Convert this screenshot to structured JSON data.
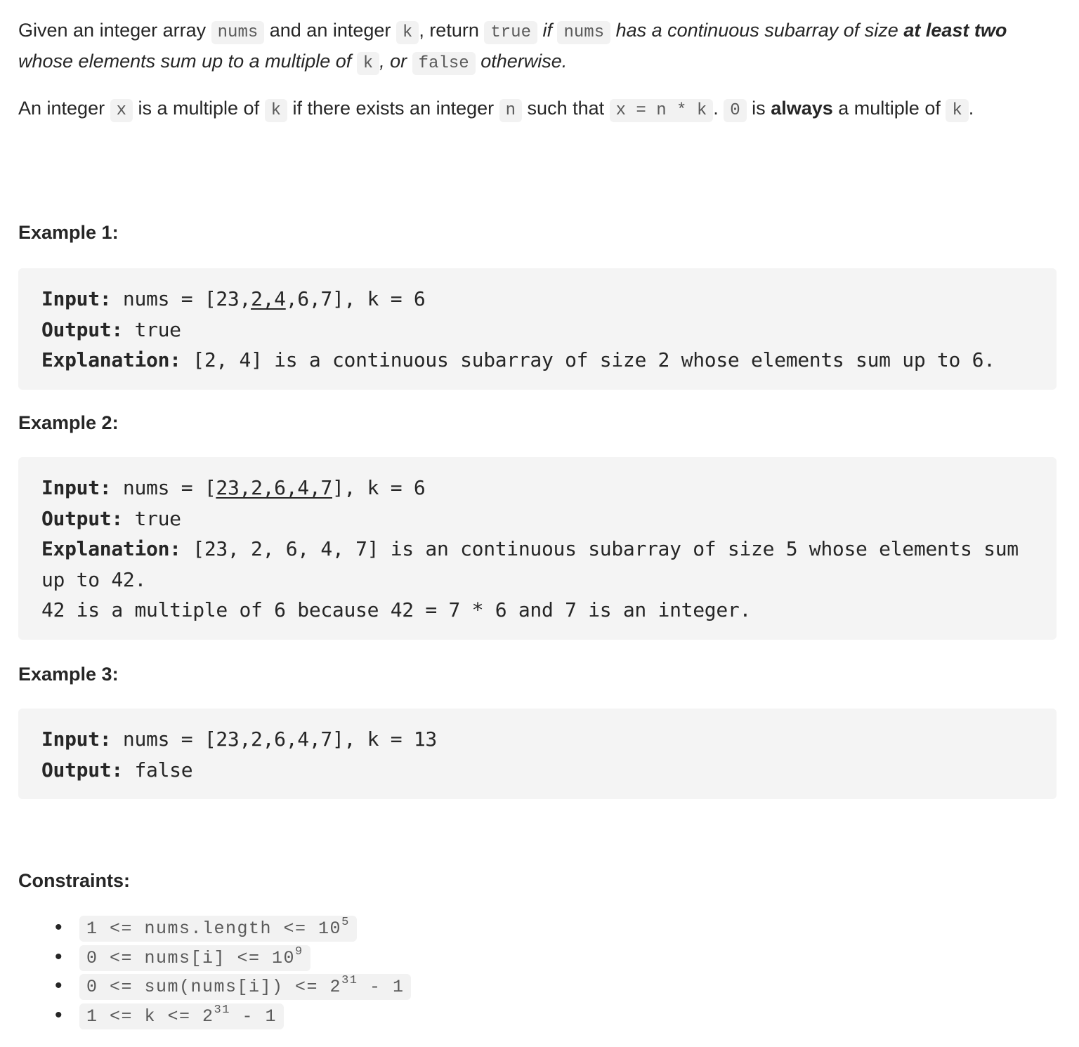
{
  "description": {
    "p1": {
      "t1": "Given an integer array ",
      "c1": "nums",
      "t2": " and an integer ",
      "c2": "k",
      "t3": ", return ",
      "c3": "true",
      "i1": " if ",
      "c4": "nums",
      "i2": " has a continuous subarray of size ",
      "b1": "at least two",
      "i3": " whose elements sum up to a multiple of ",
      "c5": "k",
      "i4": ", or ",
      "c6": "false",
      "i5": " otherwise."
    },
    "p2": {
      "t1": "An integer ",
      "c1": "x",
      "t2": " is a multiple of ",
      "c2": "k",
      "t3": " if there exists an integer ",
      "c3": "n",
      "t4": " such that ",
      "c4": "x = n * k",
      "t5": ". ",
      "c5": "0",
      "t6": " is ",
      "b1": "always",
      "t7": " a multiple of ",
      "c6": "k",
      "t8": "."
    }
  },
  "examples": [
    {
      "title": "Example 1:",
      "input_label": "Input:",
      "input_prefix": " nums = [23,",
      "input_underlined": "2,4",
      "input_suffix": ",6,7], k = 6",
      "output_label": "Output:",
      "output_value": " true",
      "explanation_label": "Explanation:",
      "explanation_text": " [2, 4] is a continuous subarray of size 2 whose elements sum up to 6."
    },
    {
      "title": "Example 2:",
      "input_label": "Input:",
      "input_prefix": " nums = [",
      "input_underlined": "23,2,6,4,7",
      "input_suffix": "], k = 6",
      "output_label": "Output:",
      "output_value": " true",
      "explanation_label": "Explanation:",
      "explanation_text": " [23, 2, 6, 4, 7] is an continuous subarray of size 5 whose elements sum up to 42.\n42 is a multiple of 6 because 42 = 7 * 6 and 7 is an integer."
    },
    {
      "title": "Example 3:",
      "input_label": "Input:",
      "input_value": " nums = [23,2,6,4,7], k = 13",
      "output_label": "Output:",
      "output_value": " false"
    }
  ],
  "constraints": {
    "title": "Constraints:",
    "items": [
      {
        "base": "1 <= nums.length <= 10",
        "sup": "5",
        "tail": ""
      },
      {
        "base": "0 <= nums[i] <= 10",
        "sup": "9",
        "tail": ""
      },
      {
        "base": "0 <= sum(nums[i]) <= 2",
        "sup": "31",
        "tail": " - 1"
      },
      {
        "base": "1 <= k <= 2",
        "sup": "31",
        "tail": " - 1"
      }
    ]
  }
}
